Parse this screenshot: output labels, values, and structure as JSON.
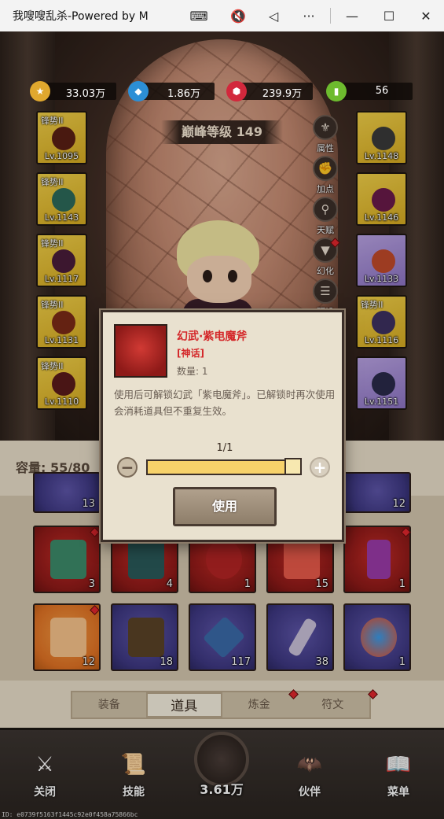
{
  "window": {
    "title": "我嗖嗖乱杀-Powered by M",
    "controls": {
      "keyboard": "⌨",
      "mute": "🔇",
      "back": "◁",
      "more": "···",
      "minimize": "—",
      "maximize": "☐",
      "close": "✕"
    }
  },
  "currencies": [
    {
      "icon": "gold-coin-icon",
      "value": "33.03万",
      "color": "#e0a82e"
    },
    {
      "icon": "blue-crystal-icon",
      "value": "1.86万",
      "color": "#2c8fd6"
    },
    {
      "icon": "red-gem-icon",
      "value": "239.9万",
      "color": "#d2283c"
    },
    {
      "icon": "green-ticket-icon",
      "value": "56",
      "color": "#6dbb2e"
    }
  ],
  "peak_level": "巅峰等级 149",
  "left_slots": [
    {
      "tier": "锋势II",
      "level": "Lv.1095"
    },
    {
      "tier": "锋势II",
      "level": "Lv.1143"
    },
    {
      "tier": "锋势II",
      "level": "Lv.1117"
    },
    {
      "tier": "锋势II",
      "level": "Lv.1131"
    },
    {
      "tier": "锋势II",
      "level": "Lv.1110"
    }
  ],
  "right_slots": [
    {
      "tier": "",
      "level": "Lv.1148",
      "color": "yellow"
    },
    {
      "tier": "",
      "level": "Lv.1146",
      "color": "yellow"
    },
    {
      "tier": "",
      "level": "Lv.1133",
      "color": "purple"
    },
    {
      "tier": "锋势II",
      "level": "Lv.1116",
      "color": "yellow"
    },
    {
      "tier": "",
      "level": "Lv.1151",
      "color": "purple"
    }
  ],
  "side_menu": [
    {
      "label": "属性",
      "icon": "attributes-icon"
    },
    {
      "label": "加点",
      "icon": "fist-icon"
    },
    {
      "label": "天赋",
      "icon": "talent-tree-icon"
    },
    {
      "label": "幻化",
      "icon": "transmog-shirt-icon"
    },
    {
      "label": "预设",
      "icon": "preset-icon"
    }
  ],
  "inventory": {
    "capacity": "容量: 55/80",
    "top_row_counts": [
      "13",
      "12"
    ],
    "rows": [
      [
        {
          "count": "3",
          "color": "red",
          "icon": "green-book-icon"
        },
        {
          "count": "4",
          "color": "red",
          "icon": "teal-card-icon"
        },
        {
          "count": "1",
          "color": "red",
          "icon": "red-pouch-icon"
        },
        {
          "count": "15",
          "color": "red",
          "icon": "mystery-box-icon"
        },
        {
          "count": "1",
          "color": "red",
          "icon": "purple-axe-icon"
        }
      ],
      [
        {
          "count": "12",
          "color": "orange",
          "icon": "mystery-box-icon"
        },
        {
          "count": "18",
          "color": "purple",
          "icon": "rune-book-icon"
        },
        {
          "count": "117",
          "color": "purple",
          "icon": "blue-crystal-icon"
        },
        {
          "count": "38",
          "color": "purple",
          "icon": "silver-feather-icon"
        },
        {
          "count": "1",
          "color": "purple",
          "icon": "fire-lightning-icon"
        }
      ]
    ]
  },
  "tabs": [
    "装备",
    "道具",
    "炼金",
    "符文"
  ],
  "active_tab": "道具",
  "bottom_nav": [
    {
      "label": "关闭",
      "icon": "close-crossed-swords-icon"
    },
    {
      "label": "技能",
      "icon": "skill-scroll-icon"
    },
    {
      "label": "伙伴",
      "icon": "companion-wings-icon"
    },
    {
      "label": "菜单",
      "icon": "menu-book-icon"
    }
  ],
  "center_value": "3.61万",
  "id_text": "ID: e0739f5163f1445c92e0f458a75866bc",
  "dialog": {
    "item_name": "幻武·紫电魔斧",
    "rarity": "[神话]",
    "quantity": "数量: 1",
    "description": "使用后可解锁幻武「紫电魔斧」。已解锁时再次使用会消耗道具但不重复生效。",
    "count": "1/1",
    "slider_fraction": 1.0,
    "use_button": "使用"
  },
  "colors": {
    "accent_red": "#d4282a",
    "panel_bg": "#e9e1cf",
    "slider_yellow": "#f7d26a"
  }
}
